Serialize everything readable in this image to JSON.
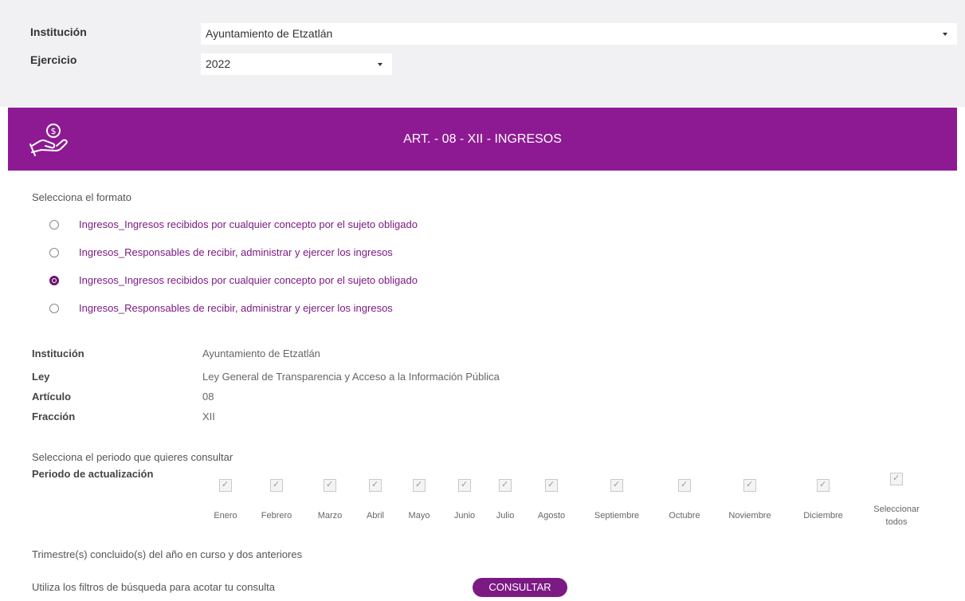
{
  "filters": {
    "institucion_label": "Institución",
    "institucion_value": "Ayuntamiento de Etzatlán",
    "ejercicio_label": "Ejercicio",
    "ejercicio_value": "2022"
  },
  "banner": {
    "title": "ART. - 08 - XII - INGRESOS",
    "icon": "hand-money-icon"
  },
  "formato": {
    "prompt": "Selecciona el formato",
    "options": [
      {
        "label": "Ingresos_Ingresos recibidos por cualquier concepto por el sujeto obligado",
        "selected": false
      },
      {
        "label": "Ingresos_Responsables de recibir, administrar y ejercer los ingresos",
        "selected": false
      },
      {
        "label": "Ingresos_Ingresos recibidos por cualquier concepto por el sujeto obligado",
        "selected": true
      },
      {
        "label": "Ingresos_Responsables de recibir, administrar y ejercer los ingresos",
        "selected": false
      }
    ]
  },
  "info": {
    "institucion_label": "Institución",
    "institucion_value": "Ayuntamiento de Etzatlán",
    "ley_label": "Ley",
    "ley_value": "Ley General de Transparencia y Acceso a la Información Pública",
    "articulo_label": "Artículo",
    "articulo_value": "08",
    "fraccion_label": "Fracción",
    "fraccion_value": "XII"
  },
  "periodo": {
    "prompt": "Selecciona el periodo que quieres consultar",
    "label": "Periodo de actualización",
    "months": [
      "Enero",
      "Febrero",
      "Marzo",
      "Abril",
      "Mayo",
      "Junio",
      "Julio",
      "Agosto",
      "Septiembre",
      "Octubre",
      "Noviembre",
      "Diciembre"
    ],
    "select_all": "Seleccionar todos"
  },
  "trimestre_note": "Trimestre(s) concluido(s) del año en curso y dos anteriores",
  "filtros_note": "Utiliza los filtros de búsqueda para acotar tu consulta",
  "consultar_label": "CONSULTAR",
  "colors": {
    "accent": "#8e1a93",
    "link": "#7c1a84",
    "topbar": "#f1f1f3"
  }
}
